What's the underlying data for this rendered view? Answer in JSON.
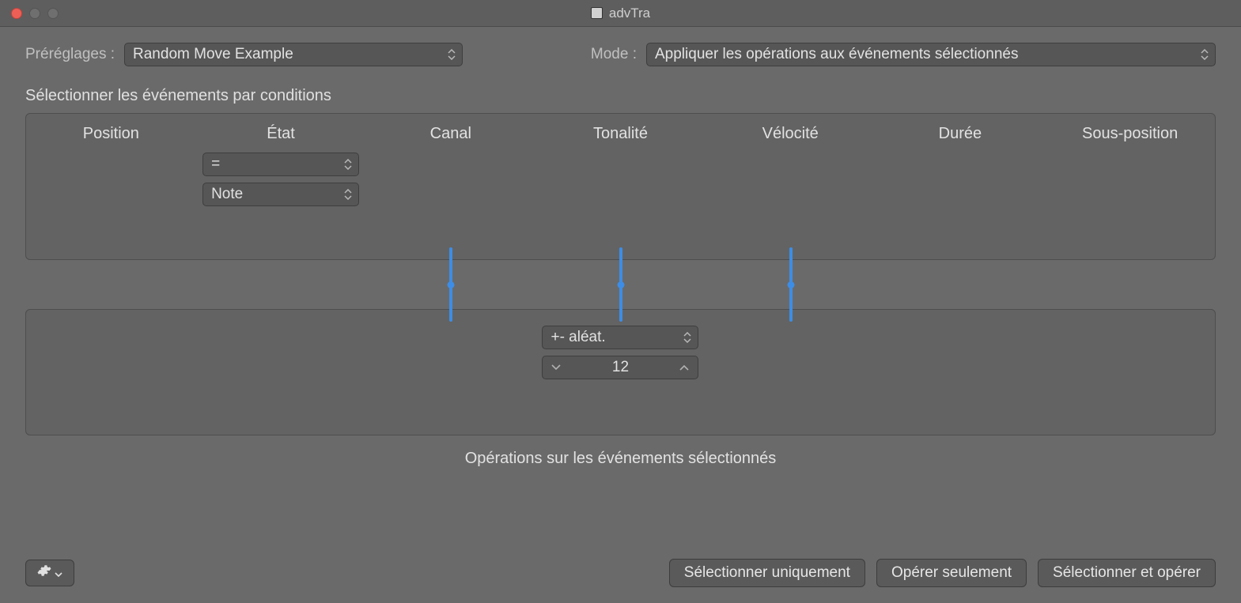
{
  "window": {
    "title": "advTra"
  },
  "top": {
    "presets_label": "Préréglages :",
    "presets_value": "Random Move Example",
    "mode_label": "Mode :",
    "mode_value": "Appliquer les opérations aux événements sélectionnés"
  },
  "section": {
    "conditions_label": "Sélectionner les événements par conditions",
    "operations_caption": "Opérations sur les événements sélectionnés"
  },
  "columns": {
    "headers": [
      "Position",
      "État",
      "Canal",
      "Tonalité",
      "Vélocité",
      "Durée",
      "Sous-position"
    ]
  },
  "conditions": {
    "etat_op": "=",
    "etat_value": "Note"
  },
  "operations": {
    "tonalite_mode": "+- aléat.",
    "tonalite_value": "12"
  },
  "footer": {
    "select_only": "Sélectionner uniquement",
    "operate_only": "Opérer seulement",
    "select_and_operate": "Sélectionner et opérer"
  }
}
